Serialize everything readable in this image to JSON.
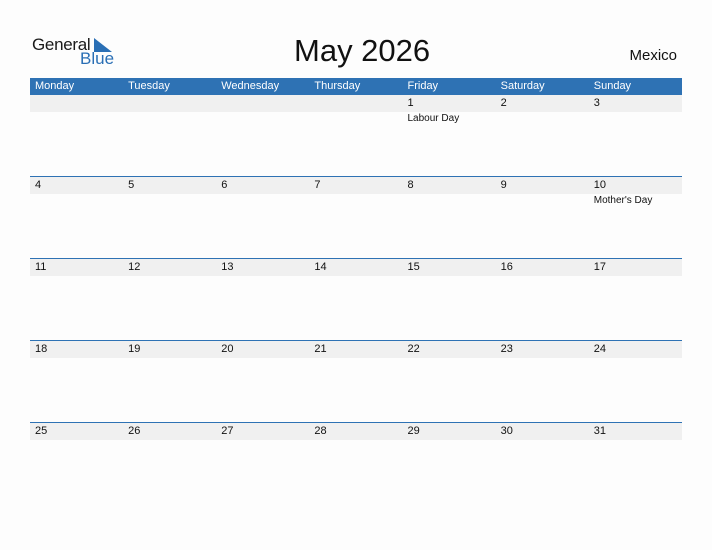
{
  "logo": {
    "general": "General",
    "blue": "Blue"
  },
  "title": "May 2026",
  "country": "Mexico",
  "weekdays": [
    "Monday",
    "Tuesday",
    "Wednesday",
    "Thursday",
    "Friday",
    "Saturday",
    "Sunday"
  ],
  "weeks": [
    [
      {
        "day": "",
        "event": ""
      },
      {
        "day": "",
        "event": ""
      },
      {
        "day": "",
        "event": ""
      },
      {
        "day": "",
        "event": ""
      },
      {
        "day": "1",
        "event": "Labour Day"
      },
      {
        "day": "2",
        "event": ""
      },
      {
        "day": "3",
        "event": ""
      }
    ],
    [
      {
        "day": "4",
        "event": ""
      },
      {
        "day": "5",
        "event": ""
      },
      {
        "day": "6",
        "event": ""
      },
      {
        "day": "7",
        "event": ""
      },
      {
        "day": "8",
        "event": ""
      },
      {
        "day": "9",
        "event": ""
      },
      {
        "day": "10",
        "event": "Mother's Day"
      }
    ],
    [
      {
        "day": "11",
        "event": ""
      },
      {
        "day": "12",
        "event": ""
      },
      {
        "day": "13",
        "event": ""
      },
      {
        "day": "14",
        "event": ""
      },
      {
        "day": "15",
        "event": ""
      },
      {
        "day": "16",
        "event": ""
      },
      {
        "day": "17",
        "event": ""
      }
    ],
    [
      {
        "day": "18",
        "event": ""
      },
      {
        "day": "19",
        "event": ""
      },
      {
        "day": "20",
        "event": ""
      },
      {
        "day": "21",
        "event": ""
      },
      {
        "day": "22",
        "event": ""
      },
      {
        "day": "23",
        "event": ""
      },
      {
        "day": "24",
        "event": ""
      }
    ],
    [
      {
        "day": "25",
        "event": ""
      },
      {
        "day": "26",
        "event": ""
      },
      {
        "day": "27",
        "event": ""
      },
      {
        "day": "28",
        "event": ""
      },
      {
        "day": "29",
        "event": ""
      },
      {
        "day": "30",
        "event": ""
      },
      {
        "day": "31",
        "event": ""
      }
    ]
  ]
}
